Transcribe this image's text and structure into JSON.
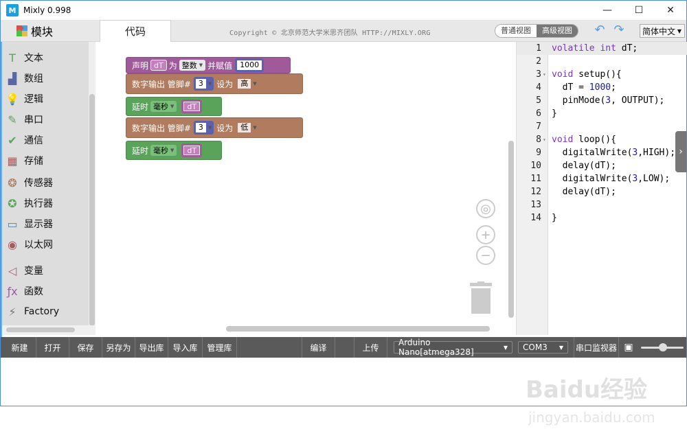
{
  "window": {
    "title": "Mixly 0.998",
    "logo_text": "M",
    "min_icon": "—",
    "max_icon": "☐",
    "close_icon": "✕"
  },
  "header": {
    "blocks_title": "模块",
    "code_tab": "代码",
    "copyright": "Copyright © 北京师范大学米思齐团队 HTTP://MIXLY.ORG",
    "view_normal": "普通视图",
    "view_advanced": "高级视图",
    "language": "简体中文"
  },
  "toolbox": {
    "items": [
      {
        "label": "文本",
        "icon": "text-icon",
        "glyph": "T",
        "color": "#5ba55b"
      },
      {
        "label": "数组",
        "icon": "array-icon",
        "glyph": "▟",
        "color": "#5b67a5"
      },
      {
        "label": "逻辑",
        "icon": "logic-icon",
        "glyph": "💡",
        "color": "#5b80a5"
      },
      {
        "label": "串口",
        "icon": "serial-icon",
        "glyph": "✎",
        "color": "#5ba55b"
      },
      {
        "label": "通信",
        "icon": "comm-icon",
        "glyph": "✔",
        "color": "#5ba55b"
      },
      {
        "label": "存储",
        "icon": "storage-icon",
        "glyph": "▦",
        "color": "#a55b5b"
      },
      {
        "label": "传感器",
        "icon": "sensor-icon",
        "glyph": "❂",
        "color": "#a5745b"
      },
      {
        "label": "执行器",
        "icon": "actuator-icon",
        "glyph": "✪",
        "color": "#5ba55b"
      },
      {
        "label": "显示器",
        "icon": "display-icon",
        "glyph": "▭",
        "color": "#5b80a5"
      },
      {
        "label": "以太网",
        "icon": "ethernet-icon",
        "glyph": "◉",
        "color": "#a55b5b"
      },
      {
        "label": "变量",
        "icon": "variable-icon",
        "glyph": "◁",
        "color": "#a55b80"
      },
      {
        "label": "函数",
        "icon": "function-icon",
        "glyph": "ƒx",
        "color": "#995ba5"
      },
      {
        "label": "Factory",
        "icon": "factory-icon",
        "glyph": "⚡",
        "color": "#777777"
      }
    ]
  },
  "workspace": {
    "block1": {
      "label1": "声明",
      "var": "dT",
      "label2": "为",
      "type": "整数",
      "label3": "并赋值",
      "value": "1000"
    },
    "block2": {
      "label1": "数字输出 管脚#",
      "pin": "3",
      "label2": "设为",
      "level": "高"
    },
    "block3": {
      "label1": "延时",
      "unit": "毫秒",
      "var": "dT"
    },
    "block4": {
      "label1": "数字输出 管脚#",
      "pin": "3",
      "label2": "设为",
      "level": "低"
    },
    "block5": {
      "label1": "延时",
      "unit": "毫秒",
      "var": "dT"
    },
    "zoom_in": "+",
    "zoom_out": "−"
  },
  "editor": {
    "lines": [
      {
        "n": "1",
        "fold": "",
        "code": "volatile int dT;"
      },
      {
        "n": "2",
        "fold": "",
        "code": ""
      },
      {
        "n": "3",
        "fold": "▾",
        "code": "void setup(){"
      },
      {
        "n": "4",
        "fold": "",
        "code": "  dT = 1000;"
      },
      {
        "n": "5",
        "fold": "",
        "code": "  pinMode(3, OUTPUT);"
      },
      {
        "n": "6",
        "fold": "",
        "code": "}"
      },
      {
        "n": "7",
        "fold": "",
        "code": ""
      },
      {
        "n": "8",
        "fold": "▾",
        "code": "void loop(){"
      },
      {
        "n": "9",
        "fold": "",
        "code": "  digitalWrite(3,HIGH);"
      },
      {
        "n": "10",
        "fold": "",
        "code": "  delay(dT);"
      },
      {
        "n": "11",
        "fold": "",
        "code": "  digitalWrite(3,LOW);"
      },
      {
        "n": "12",
        "fold": "",
        "code": "  delay(dT);"
      },
      {
        "n": "13",
        "fold": "",
        "code": ""
      },
      {
        "n": "14",
        "fold": "",
        "code": "}"
      }
    ]
  },
  "bottombar": {
    "new": "新建",
    "open": "打开",
    "save": "保存",
    "save_as": "另存为",
    "export_lib": "导出库",
    "import_lib": "导入库",
    "manage_lib": "管理库",
    "compile": "编译",
    "upload": "上传",
    "board": "Arduino Nano[atmega328]",
    "port": "COM3",
    "serial_monitor": "串口监视器"
  },
  "watermark": {
    "main": "Baidu经验",
    "sub": "jingyan.baidu.com"
  }
}
